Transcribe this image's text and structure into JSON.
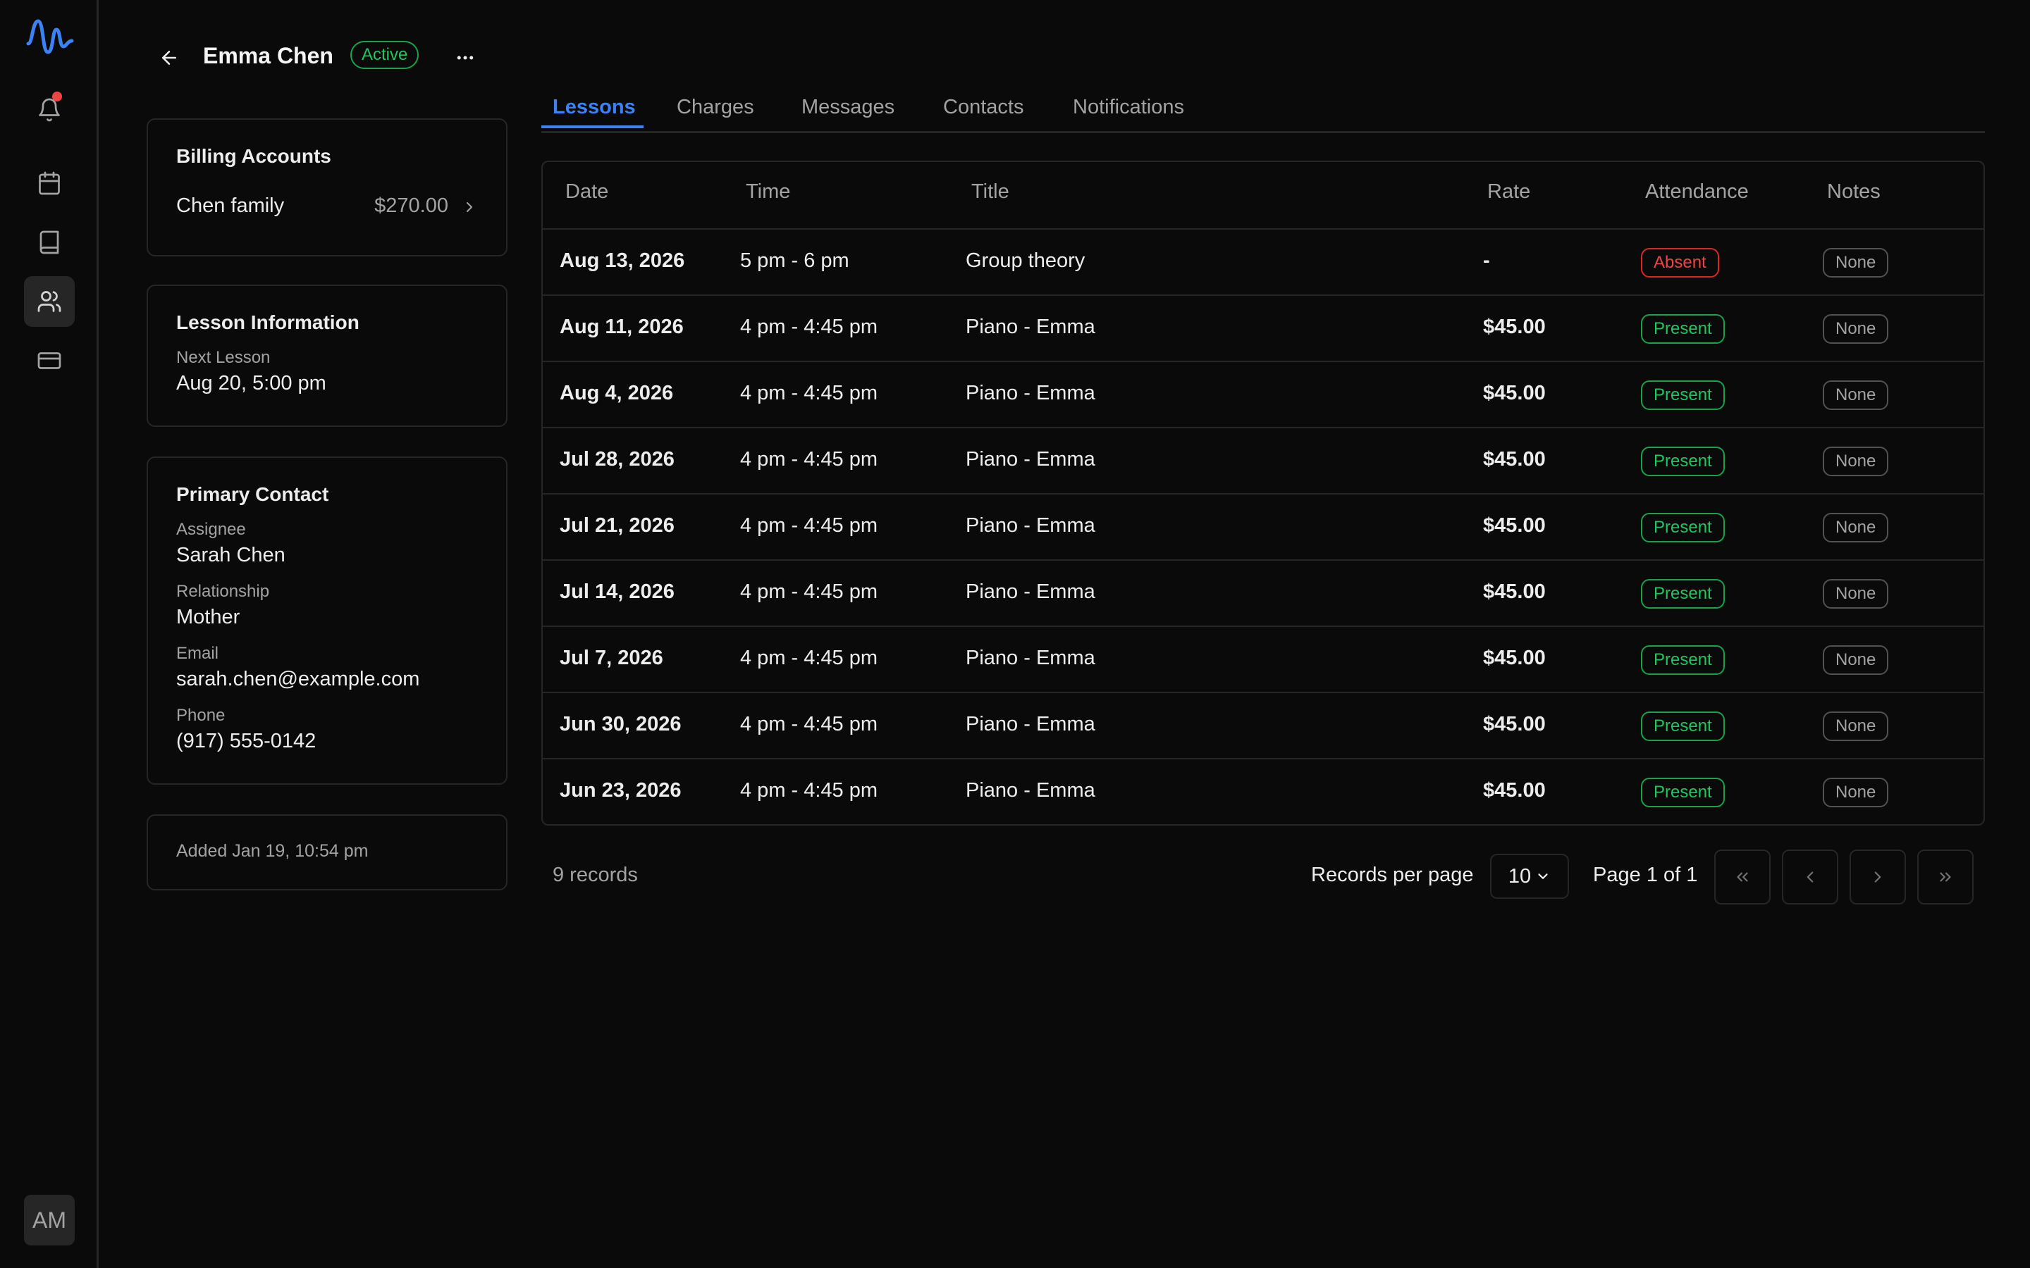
{
  "sidebar": {
    "items": [
      {
        "icon": "bell-icon",
        "has_notification": true
      },
      {
        "icon": "calendar-icon"
      },
      {
        "icon": "book-icon"
      },
      {
        "icon": "users-icon",
        "active": true
      },
      {
        "icon": "credit-card-icon"
      }
    ],
    "avatar_initials": "AM"
  },
  "header": {
    "name": "Emma Chen",
    "status": "Active"
  },
  "billing": {
    "title": "Billing Accounts",
    "account_name": "Chen family",
    "amount": "$270.00"
  },
  "lesson_info": {
    "title": "Lesson Information",
    "next_label": "Next Lesson",
    "next_value": "Aug 20, 5:00 pm"
  },
  "contact": {
    "title": "Primary Contact",
    "assignee_label": "Assignee",
    "assignee": "Sarah Chen",
    "relationship_label": "Relationship",
    "relationship": "Mother",
    "email_label": "Email",
    "email": "sarah.chen@example.com",
    "phone_label": "Phone",
    "phone": "(917) 555-0142"
  },
  "added": "Added Jan 19, 10:54 pm",
  "tabs": [
    "Lessons",
    "Charges",
    "Messages",
    "Contacts",
    "Notifications"
  ],
  "table": {
    "headers": [
      "Date",
      "Time",
      "Title",
      "Rate",
      "Attendance",
      "Notes"
    ],
    "rows": [
      {
        "date": "Aug 13, 2026",
        "time": "5 pm - 6 pm",
        "title": "Group theory",
        "rate": "-",
        "attendance": "Absent",
        "notes": "None"
      },
      {
        "date": "Aug 11, 2026",
        "time": "4 pm - 4:45 pm",
        "title": "Piano - Emma",
        "rate": "$45.00",
        "attendance": "Present",
        "notes": "None"
      },
      {
        "date": "Aug 4, 2026",
        "time": "4 pm - 4:45 pm",
        "title": "Piano - Emma",
        "rate": "$45.00",
        "attendance": "Present",
        "notes": "None"
      },
      {
        "date": "Jul 28, 2026",
        "time": "4 pm - 4:45 pm",
        "title": "Piano - Emma",
        "rate": "$45.00",
        "attendance": "Present",
        "notes": "None"
      },
      {
        "date": "Jul 21, 2026",
        "time": "4 pm - 4:45 pm",
        "title": "Piano - Emma",
        "rate": "$45.00",
        "attendance": "Present",
        "notes": "None"
      },
      {
        "date": "Jul 14, 2026",
        "time": "4 pm - 4:45 pm",
        "title": "Piano - Emma",
        "rate": "$45.00",
        "attendance": "Present",
        "notes": "None"
      },
      {
        "date": "Jul 7, 2026",
        "time": "4 pm - 4:45 pm",
        "title": "Piano - Emma",
        "rate": "$45.00",
        "attendance": "Present",
        "notes": "None"
      },
      {
        "date": "Jun 30, 2026",
        "time": "4 pm - 4:45 pm",
        "title": "Piano - Emma",
        "rate": "$45.00",
        "attendance": "Present",
        "notes": "None"
      },
      {
        "date": "Jun 23, 2026",
        "time": "4 pm - 4:45 pm",
        "title": "Piano - Emma",
        "rate": "$45.00",
        "attendance": "Present",
        "notes": "None"
      }
    ]
  },
  "pagination": {
    "records": "9 records",
    "per_page_label": "Records per page",
    "per_page": "10",
    "page_label": "Page 1 of 1"
  },
  "colors": {
    "accent": "#3b82f6",
    "present": "#22c55e",
    "absent": "#ef4444",
    "notification": "#ef4444"
  }
}
